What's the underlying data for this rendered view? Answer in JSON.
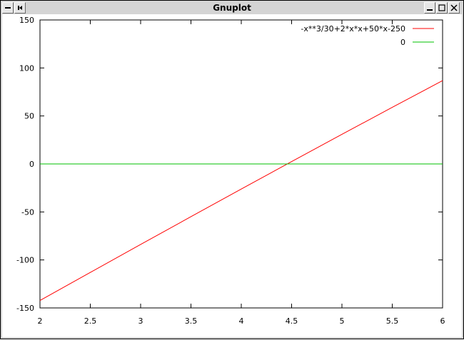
{
  "window": {
    "title": "Gnuplot",
    "icons": [
      "window-menu-icon",
      "shade-icon",
      "minimize-icon",
      "maximize-icon",
      "close-icon"
    ]
  },
  "chart_data": {
    "type": "line",
    "title": "",
    "xlabel": "",
    "ylabel": "",
    "xlim": [
      2,
      6
    ],
    "ylim": [
      -150,
      150
    ],
    "x_ticks": [
      2,
      2.5,
      3,
      3.5,
      4,
      4.5,
      5,
      5.5,
      6
    ],
    "x_tick_labels": [
      "2",
      "2.5",
      "3",
      "3.5",
      "4",
      "4.5",
      "5",
      "5.5",
      "6"
    ],
    "y_ticks": [
      -150,
      -100,
      -50,
      0,
      50,
      100,
      150
    ],
    "y_tick_labels": [
      "-150",
      "-100",
      "-50",
      "0",
      "50",
      "100",
      "150"
    ],
    "grid": false,
    "legend_position": "top-right",
    "series": [
      {
        "name": "-x**3/30+2*x*x+50*x-250",
        "color": "#ff0000",
        "x": [
          2,
          2.5,
          3,
          3.5,
          4,
          4.5,
          5,
          5.5,
          6
        ],
        "y": [
          -142.27,
          -113.02,
          -83.9,
          -54.93,
          -26.13,
          2.46,
          30.83,
          58.95,
          86.8
        ]
      },
      {
        "name": "0",
        "color": "#00c000",
        "x": [
          2,
          6
        ],
        "y": [
          0,
          0
        ]
      }
    ]
  }
}
